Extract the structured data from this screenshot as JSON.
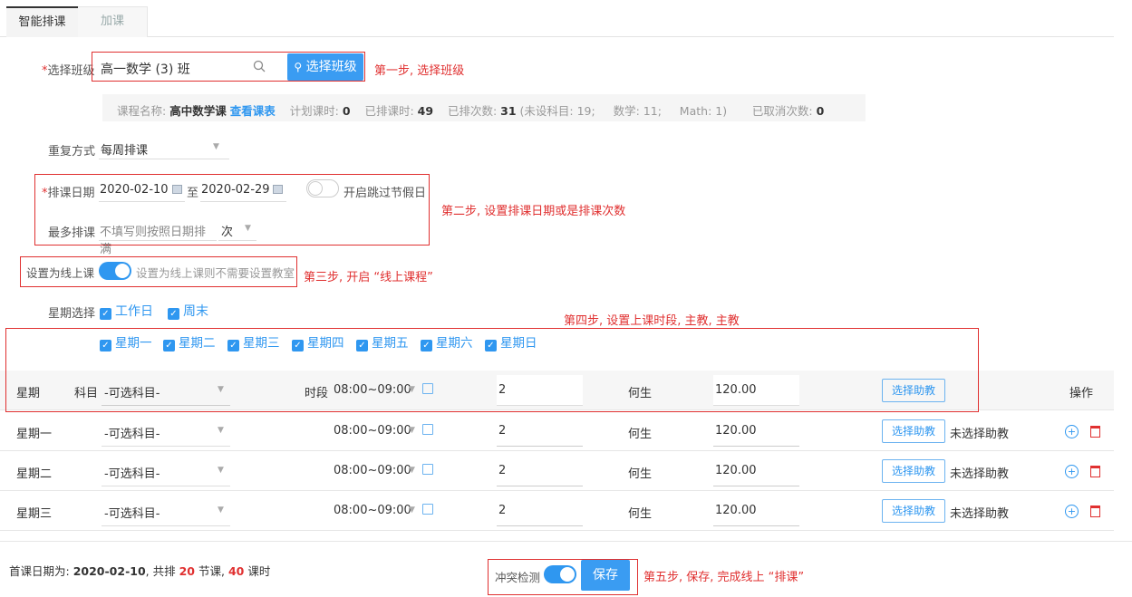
{
  "tabs": [
    {
      "label": "智能排课"
    },
    {
      "label": "加课"
    }
  ],
  "form": {
    "class_label_star": "*",
    "class_label": "选择班级",
    "class_value": "高一数学 (3) 班",
    "select_class_button": "选择班级",
    "course_info": {
      "course_name_label": "课程名称:",
      "course_name": "高中数学课",
      "view_schedule": "查看课表",
      "planned_label": "计划课时:",
      "planned": "0",
      "scheduled_label": "已排课时:",
      "scheduled": "49",
      "sessions_label": "已排次数:",
      "sessions": "31",
      "detail": "(未设科目: 19;",
      "math_cn": "数学: 11;",
      "math_en": "Math: 1)",
      "cancelled_label": "已取消次数:",
      "cancelled": "0"
    },
    "repeat_label": "重复方式",
    "repeat_value": "每周排课",
    "date_label_star": "*",
    "date_label": "排课日期",
    "date_start": "2020-02-10",
    "date_to": "至",
    "date_end": "2020-02-29",
    "skip_holiday": "开启跳过节假日",
    "max_label": "最多排课",
    "max_placeholder": "不填写则按照日期排满",
    "max_unit": "次",
    "online_label": "设置为线上课",
    "online_hint": "设置为线上课则不需要设置教室",
    "week_label": "星期选择",
    "week_groups": [
      "工作日",
      "周末"
    ],
    "weekdays": [
      "星期一",
      "星期二",
      "星期三",
      "星期四",
      "星期五",
      "星期六",
      "星期日"
    ]
  },
  "annotations": {
    "step1": "第一步, 选择班级",
    "step2": "第二步, 设置排课日期或是排课次数",
    "step3": "第三步, 开启 “线上课程”",
    "step4": "第四步, 设置上课时段, 主教, 主教",
    "step5": "第五步, 保存, 完成线上 “排课”"
  },
  "table": {
    "header": {
      "weekday": "星期",
      "subject_label": "科目",
      "subject": "-可选科目-",
      "period_label": "时段",
      "period": "08:00~09:00",
      "hours": "2",
      "teacher": "何生",
      "price": "120.00",
      "assistant_button": "选择助教",
      "ops": "操作"
    },
    "rows": [
      {
        "weekday": "星期一",
        "subject": "-可选科目-",
        "period": "08:00~09:00",
        "hours": "2",
        "teacher": "何生",
        "price": "120.00",
        "assistant_button": "选择助教",
        "assistant": "未选择助教"
      },
      {
        "weekday": "星期二",
        "subject": "-可选科目-",
        "period": "08:00~09:00",
        "hours": "2",
        "teacher": "何生",
        "price": "120.00",
        "assistant_button": "选择助教",
        "assistant": "未选择助教"
      },
      {
        "weekday": "星期三",
        "subject": "-可选科目-",
        "period": "08:00~09:00",
        "hours": "2",
        "teacher": "何生",
        "price": "120.00",
        "assistant_button": "选择助教",
        "assistant": "未选择助教"
      }
    ]
  },
  "footer": {
    "first_label": "首课日期为:",
    "first_date": "2020-02-10",
    "total_prefix": ", 共排",
    "lessons": "20",
    "lessons_unit": "节课,",
    "hours": "40",
    "hours_unit": "课时",
    "conflict_label": "冲突检测",
    "save_button": "保存"
  },
  "colors": {
    "accent": "#2f97f0",
    "annotation": "#e03030"
  }
}
